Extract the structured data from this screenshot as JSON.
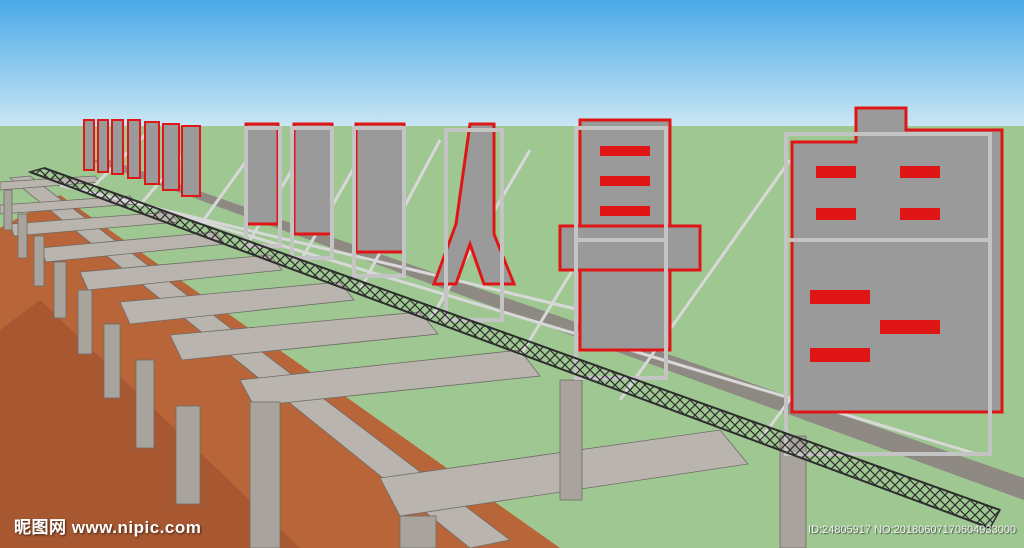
{
  "colors": {
    "sky_top": "#4aa9e8",
    "sky_bottom": "#c9e6f4",
    "ground": "#9fc792",
    "soil": "#b8653a",
    "steel": "#c4c4c4",
    "timber_top": "#b9b4ad",
    "timber_side": "#8e8983",
    "sign_face": "#9a9a9a",
    "sign_edge": "#e01616",
    "truss": "#2e2e2e"
  },
  "icons": [
    "photo-watermark-logo"
  ],
  "watermark": {
    "site_text": "昵图网 www.nipic.com",
    "id_text": "ID:24805917 NO:20180607170604933000"
  }
}
